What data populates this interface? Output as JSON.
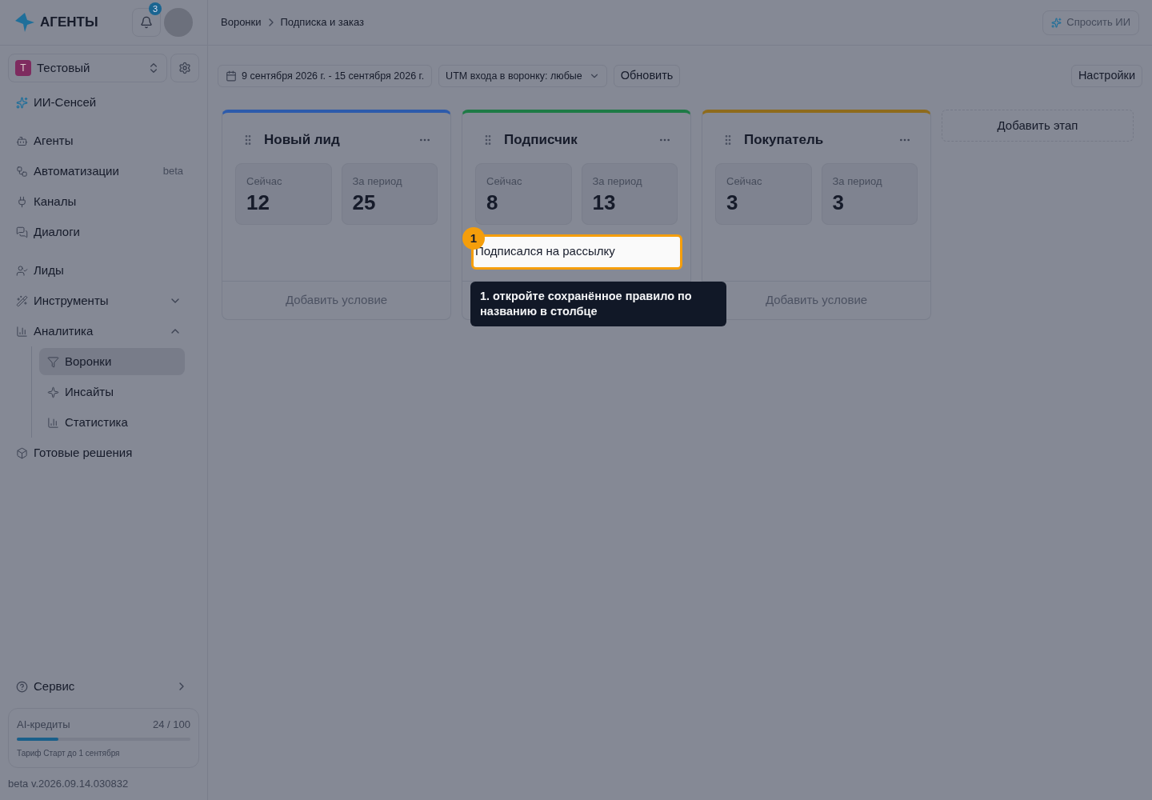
{
  "sidebar": {
    "logo_text": "АГЕНТЫ",
    "notifications": "3",
    "workspace": {
      "initial": "Т",
      "name": "Тестовый"
    },
    "ai_item": "ИИ-Сенсей",
    "groups": [
      [
        {
          "label": "Агенты"
        },
        {
          "label": "Автоматизации",
          "badge": "beta"
        },
        {
          "label": "Каналы"
        },
        {
          "label": "Диалоги"
        }
      ],
      [
        {
          "label": "Лиды"
        },
        {
          "label": "Инструменты",
          "expanded": false
        },
        {
          "label": "Аналитика",
          "expanded": true,
          "children": [
            {
              "label": "Воронки",
              "selected": true
            },
            {
              "label": "Инсайты",
              "selected": false
            },
            {
              "label": "Статистика",
              "selected": false
            }
          ]
        },
        {
          "label": "Готовые решения"
        }
      ]
    ],
    "service": "Сервис",
    "credits": {
      "title": "AI-кредиты",
      "reading": "24 / 100",
      "level": 0.24,
      "plan": "Тариф Старт до 1 сентября"
    },
    "version": "beta v.2026.09.14.030832"
  },
  "header": {
    "breadcrumbs": [
      "Воронки",
      "Подписка и заказ"
    ],
    "ask_ai": "Спросить ИИ"
  },
  "toolbar": {
    "date_range": "9 сентября 2026 г. - 15 сентября 2026 г.",
    "utm": "UTM входа в воронку: любые",
    "refresh": "Обновить",
    "settings": "Настройки"
  },
  "stages": [
    {
      "title": "Новый лид",
      "color": "#2d5bab",
      "now_label": "Сейчас",
      "now": "12",
      "period_label": "За период",
      "period": "25",
      "add_condition": "Добавить условие"
    },
    {
      "title": "Подписчик",
      "color": "#1e7a46",
      "now_label": "Сейчас",
      "now": "8",
      "period_label": "За период",
      "period": "13",
      "conditions": [
        {
          "label": "Подписался на рассылку",
          "highlighted": true
        }
      ]
    },
    {
      "title": "Покупатель",
      "color": "#8e6b1c",
      "now_label": "Сейчас",
      "now": "3",
      "period_label": "За период",
      "period": "3",
      "add_condition": "Добавить условие"
    }
  ],
  "add_stage": "Добавить этап",
  "tour": {
    "step": "1",
    "text": "1. откройте сохранённое правило по названию в столбце"
  }
}
